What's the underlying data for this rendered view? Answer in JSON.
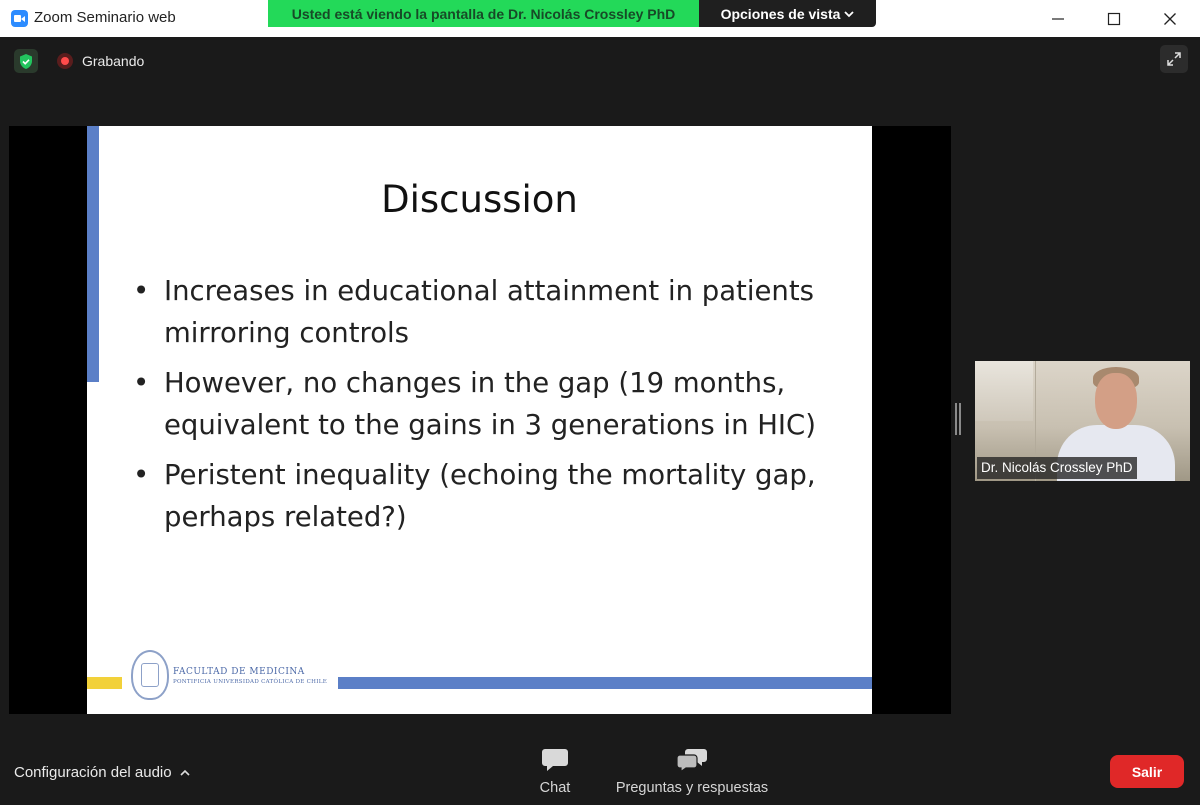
{
  "window": {
    "title": "Zoom Seminario web",
    "share_banner": "Usted está viendo la pantalla de Dr. Nicolás Crossley PhD",
    "view_options": "Opciones de vista"
  },
  "meeting": {
    "recording_label": "Grabando"
  },
  "slide": {
    "title": "Discussion",
    "bullets": [
      "Increases in educational attainment in patients mirroring controls",
      "However, no changes in the gap (19 months, equivalent to the gains in 3 generations in HIC)",
      "Peristent inequality (echoing the mortality gap, perhaps related?)"
    ],
    "footer_title": "FACULTAD DE MEDICINA",
    "footer_subtitle": "PONTIFICIA UNIVERSIDAD CATÓLICA DE CHILE",
    "accent_blue": "#5b7fc7",
    "accent_yellow": "#f2d13a"
  },
  "participant": {
    "name": "Dr. Nicolás Crossley PhD"
  },
  "toolbar": {
    "audio_settings": "Configuración del audio",
    "chat": "Chat",
    "qa": "Preguntas y respuestas",
    "leave": "Salir"
  },
  "colors": {
    "share_banner_bg": "#23d959",
    "leave_button": "#e02828",
    "zoom_blue": "#2d8cff"
  }
}
